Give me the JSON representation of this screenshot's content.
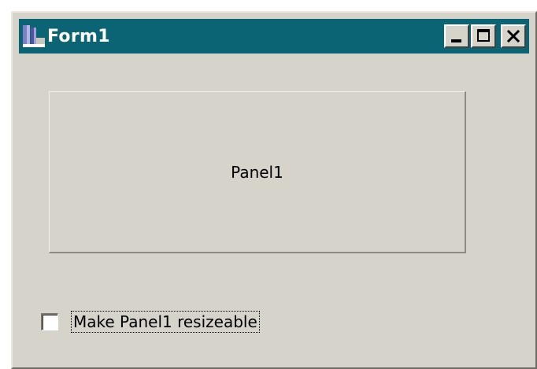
{
  "window": {
    "title": "Form1",
    "title_bar_color": "#0a6474",
    "body_color": "#d6d3ca"
  },
  "title_buttons": {
    "minimize_icon": "minimize-icon",
    "maximize_icon": "maximize-icon",
    "close_icon": "close-icon"
  },
  "panel": {
    "caption": "Panel1"
  },
  "checkbox": {
    "label": "Make Panel1 resizeable",
    "checked": false
  }
}
